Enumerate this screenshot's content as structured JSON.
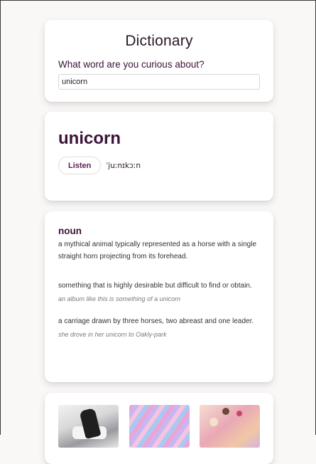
{
  "search": {
    "app_title": "Dictionary",
    "prompt": "What word are you curious about?",
    "value": "unicorn"
  },
  "word": {
    "headword": "unicorn",
    "listen_label": "Listen",
    "phonetic": "ˈjuːnɪkɔːn"
  },
  "definitions": {
    "part_of_speech": "noun",
    "meanings": [
      {
        "definition": "a mythical animal typically represented as a horse with a single straight horn projecting from its forehead.",
        "example": ""
      },
      {
        "definition": "something that is highly desirable but difficult to find or obtain.",
        "example": "an album like this is something of a unicorn"
      },
      {
        "definition": "a carriage drawn by three horses, two abreast and one leader.",
        "example": "she drove in her unicorn to Oakly-park"
      }
    ]
  },
  "photos": {
    "items": [
      {
        "subject": "unicorn costume photo"
      },
      {
        "subject": "pastel swirl pattern"
      },
      {
        "subject": "unicorn cake decorations"
      }
    ]
  },
  "colors": {
    "background": "#faf8f7",
    "text": "#2a1628",
    "accent": "#3b1338",
    "button_text": "#5b1f55"
  }
}
